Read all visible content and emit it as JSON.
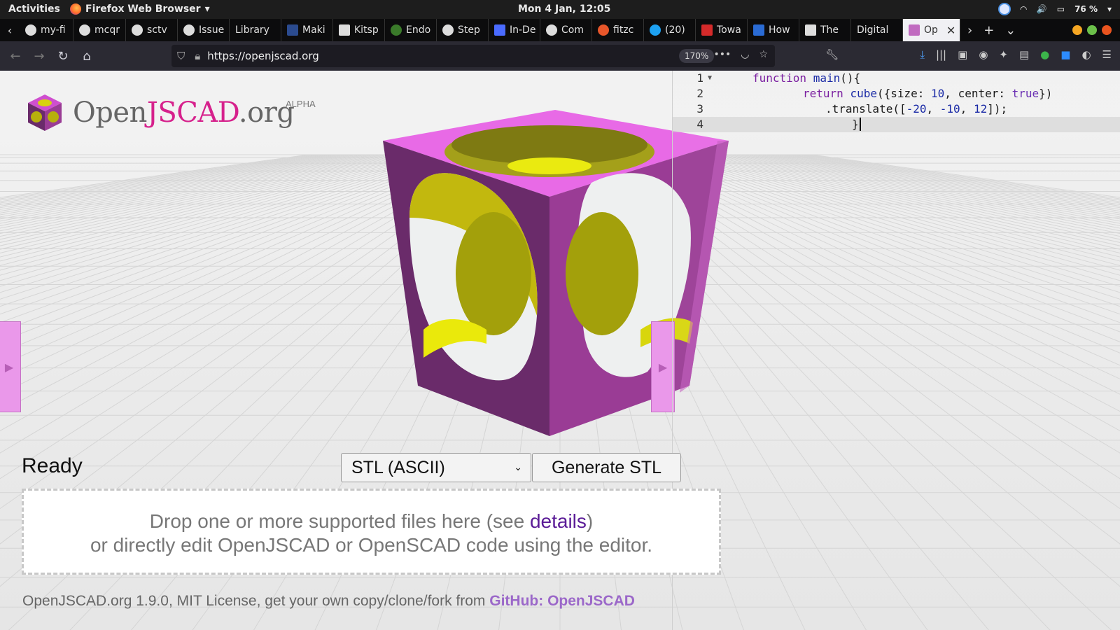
{
  "topbar": {
    "activities": "Activities",
    "app_name": "Firefox Web Browser",
    "clock": "Mon  4 Jan, 12:05",
    "battery": "76 %"
  },
  "tabs": [
    {
      "label": "my-fi"
    },
    {
      "label": "mcqr"
    },
    {
      "label": "sctv"
    },
    {
      "label": "Issue"
    },
    {
      "label": "Library"
    },
    {
      "label": "Maki"
    },
    {
      "label": "Kitsp"
    },
    {
      "label": "Endo"
    },
    {
      "label": "Step"
    },
    {
      "label": "In-De"
    },
    {
      "label": "Com"
    },
    {
      "label": "fitzc"
    },
    {
      "label": "(20)"
    },
    {
      "label": "Towa"
    },
    {
      "label": "How"
    },
    {
      "label": "The"
    },
    {
      "label": "Digital"
    },
    {
      "label": "Op",
      "active": true
    }
  ],
  "navbar": {
    "url": "https://openjscad.org",
    "zoom": "170%"
  },
  "logo": {
    "open": "Open",
    "js": "JSCAD",
    "org": ".org",
    "alpha": "ALPHA"
  },
  "editor": {
    "lines": [
      {
        "num": "1"
      },
      {
        "num": "2"
      },
      {
        "num": "3"
      },
      {
        "num": "4"
      }
    ],
    "code": {
      "l1_kw": "function",
      "l1_fn": "main",
      "l1_rest": "(){",
      "l2_kw": "return",
      "l2_fn": "cube",
      "l2_a": "({size: ",
      "l2_num": "10",
      "l2_b": ", center: ",
      "l2_bool": "true",
      "l2_c": "})",
      "l3_a": ".translate([",
      "l3_n1": "-20",
      "l3_c1": ", ",
      "l3_n2": "-10",
      "l3_c2": ", ",
      "l3_n3": "12",
      "l3_b": "]);",
      "l4": "}"
    }
  },
  "status": "Ready",
  "format_select": {
    "value": "STL (ASCII)"
  },
  "generate_button": "Generate STL",
  "dropzone": {
    "line1_a": "Drop one or more supported files here (see ",
    "line1_link": "details",
    "line1_b": ")",
    "line2": "or directly edit OpenJSCAD or OpenSCAD code using the editor."
  },
  "footer": {
    "text": "OpenJSCAD.org 1.9.0, MIT License, get your own copy/clone/fork from ",
    "link": "GitHub: OpenJSCAD"
  },
  "colors": {
    "accent_magenta": "#d6218c",
    "cube_top": "#e86ae6",
    "cube_left": "#9a3c95",
    "cube_right": "#c45ac0",
    "sphere_yellow": "#b7b00c"
  }
}
